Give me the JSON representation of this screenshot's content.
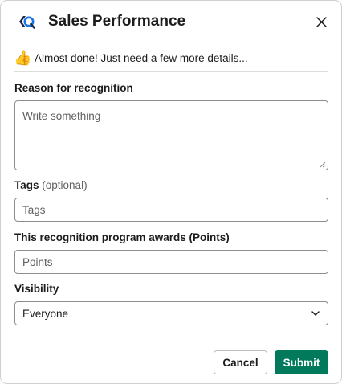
{
  "header": {
    "title": "Sales Performance",
    "logo_icon": "brand-logo-icon",
    "close_icon": "close-icon"
  },
  "banner": {
    "emoji": "👍",
    "text": "Almost done! Just need a few more details..."
  },
  "form": {
    "reason": {
      "label": "Reason for recognition",
      "placeholder": "Write something"
    },
    "tags": {
      "label": "Tags",
      "optional": "(optional)",
      "placeholder": "Tags"
    },
    "points": {
      "label": "This recognition program awards (Points)",
      "placeholder": "Points"
    },
    "visibility": {
      "label": "Visibility",
      "value": "Everyone"
    }
  },
  "footer": {
    "cancel_label": "Cancel",
    "submit_label": "Submit"
  },
  "colors": {
    "submit": "#007a5a",
    "logo_accent": "#1a73e8",
    "logo_dark": "#1b2a4a"
  }
}
